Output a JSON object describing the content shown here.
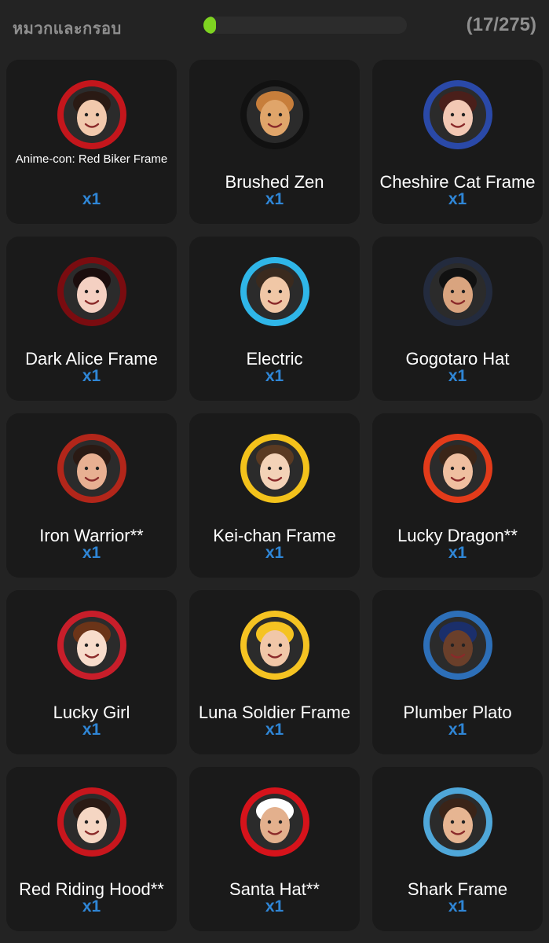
{
  "header": {
    "title": "หมวกและกรอบ",
    "progress": 0.062,
    "progress_color": "#7ed321",
    "count": "(17/275)"
  },
  "items": [
    {
      "name": "Anime-con: Red Biker Frame",
      "qty": "x1",
      "accent": "#c4161c",
      "skin": "#f1c9ad",
      "hair": "#2a1a14",
      "icon": "red-biker-frame-icon",
      "small": true
    },
    {
      "name": "Brushed Zen",
      "qty": "x1",
      "accent": "#111111",
      "skin": "#e0a56a",
      "hair": "#c77e3b",
      "icon": "brushed-zen-icon"
    },
    {
      "name": "Cheshire Cat Frame",
      "qty": "x1",
      "accent": "#2a49a8",
      "skin": "#f2c8b4",
      "hair": "#4a1f1a",
      "icon": "cheshire-cat-frame-icon"
    },
    {
      "name": "Dark Alice Frame",
      "qty": "x1",
      "accent": "#7a0c10",
      "skin": "#f4d0c2",
      "hair": "#1b0d0d",
      "icon": "dark-alice-frame-icon"
    },
    {
      "name": "Electric",
      "qty": "x1",
      "accent": "#2fb6e8",
      "skin": "#f0c7a6",
      "hair": "#3a2a1e",
      "icon": "electric-frame-icon"
    },
    {
      "name": "Gogotaro Hat",
      "qty": "x1",
      "accent": "#232b3e",
      "skin": "#d9a47f",
      "hair": "#111111",
      "icon": "gogotaro-hat-icon"
    },
    {
      "name": "Iron Warrior**",
      "qty": "x1",
      "accent": "#b2261a",
      "skin": "#e8b092",
      "hair": "#2a1a14",
      "icon": "iron-warrior-icon"
    },
    {
      "name": "Kei-chan Frame",
      "qty": "x1",
      "accent": "#f3c21b",
      "skin": "#f3d2b7",
      "hair": "#5a3a22",
      "icon": "kei-chan-frame-icon"
    },
    {
      "name": "Lucky Dragon**",
      "qty": "x1",
      "accent": "#e23b1a",
      "skin": "#efbfa0",
      "hair": "#3a2518",
      "icon": "lucky-dragon-icon"
    },
    {
      "name": "Lucky Girl",
      "qty": "x1",
      "accent": "#c81e2a",
      "skin": "#f7dccb",
      "hair": "#6b3418",
      "icon": "lucky-girl-icon"
    },
    {
      "name": "Luna Soldier Frame",
      "qty": "x1",
      "accent": "#f5c322",
      "skin": "#f1c7a8",
      "hair": "#f5c322",
      "icon": "luna-soldier-frame-icon"
    },
    {
      "name": "Plumber Plato",
      "qty": "x1",
      "accent": "#2d6fb8",
      "skin": "#6a3f2a",
      "hair": "#1b2f6b",
      "icon": "plumber-plato-icon"
    },
    {
      "name": "Red Riding Hood**",
      "qty": "x1",
      "accent": "#c8161d",
      "skin": "#f5d6c3",
      "hair": "#2a1a14",
      "icon": "red-riding-hood-icon"
    },
    {
      "name": "Santa Hat**",
      "qty": "x1",
      "accent": "#d6131b",
      "skin": "#e3b08d",
      "hair": "#ffffff",
      "icon": "santa-hat-icon"
    },
    {
      "name": "Shark Frame",
      "qty": "x1",
      "accent": "#4fa7d9",
      "skin": "#e6b592",
      "hair": "#3a2418",
      "icon": "shark-frame-icon"
    }
  ]
}
